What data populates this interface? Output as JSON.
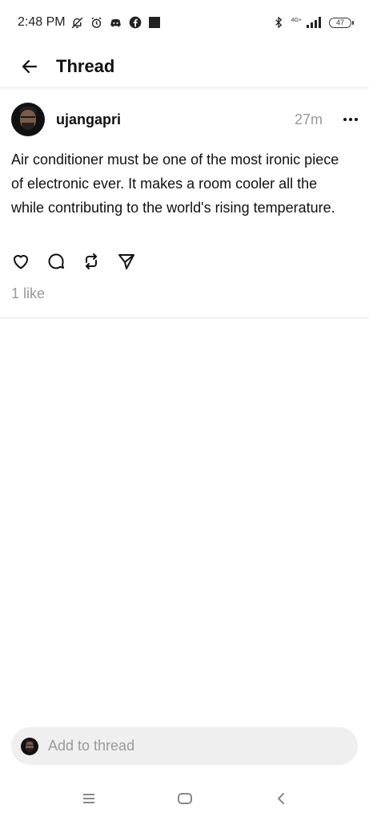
{
  "status_bar": {
    "time": "2:48 PM",
    "network_label": "4G+",
    "battery": "47",
    "icons": [
      "silent-icon",
      "alarm-icon",
      "discord-icon",
      "facebook-icon",
      "stop-square-icon",
      "bluetooth-icon",
      "signal-icon",
      "battery-icon"
    ]
  },
  "header": {
    "title": "Thread"
  },
  "post": {
    "username": "ujangapri",
    "timestamp": "27m",
    "body": "Air conditioner must be one of the most ironic piece of electronic ever. It makes a room cooler all the while contributing to the world's rising temperature.",
    "likes": "1 like"
  },
  "composer": {
    "placeholder": "Add to thread"
  },
  "colors": {
    "text": "#111111",
    "muted": "#999999",
    "divider": "#e6e6e6",
    "composer_bg": "#efefef"
  }
}
